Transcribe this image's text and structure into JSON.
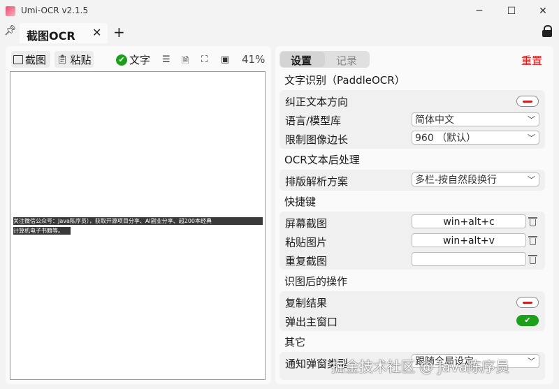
{
  "window": {
    "title": "Umi-OCR v2.1.5",
    "min_icon": "minimize-icon",
    "max_icon": "maximize-icon",
    "close_icon": "close-icon"
  },
  "tabs": {
    "active_label": "截图OCR",
    "pin_icon": "pin-icon",
    "close_icon": "close-icon",
    "add_icon": "plus-icon",
    "lock_icon": "lock-icon"
  },
  "left_toolbar": {
    "screenshot_label": "截图",
    "paste_label": "粘贴",
    "text_label": "文字",
    "zoom": "41%"
  },
  "ocr_preview": {
    "line1": "关注微信公众号：Java陈序员），获取开源项目分享、AI副业分享、超200本经典",
    "line2": "计算机电子书籍等。"
  },
  "right_panel": {
    "tab_settings": "设置",
    "tab_records": "记录",
    "reset_label": "重置",
    "section_ocr": "文字识别（PaddleOCR）",
    "row_correct_direction": "纠正文本方向",
    "row_language": "语言/模型库",
    "language_value": "简体中文",
    "row_limit_side": "限制图像边长",
    "limit_side_value": "960 （默认）",
    "section_post": "OCR文本后处理",
    "row_layout": "排版解析方案",
    "layout_value": "多栏-按自然段换行",
    "section_hotkeys": "快捷键",
    "row_screenshot": "屏幕截图",
    "screenshot_hotkey": "win+alt+c",
    "row_paste": "粘贴图片",
    "paste_hotkey": "win+alt+v",
    "row_repeat": "重复截图",
    "repeat_hotkey": "",
    "section_after": "识图后的操作",
    "row_copy_result": "复制结果",
    "row_popup_main": "弹出主窗口",
    "section_other": "其它",
    "row_notify_type": "通知弹窗类型",
    "notify_value": "跟随全局设定"
  },
  "watermark": "掘金技术社区 @ Java陈序员",
  "colors": {
    "accent_green": "#1ca01c",
    "reset_red": "#e02020"
  }
}
